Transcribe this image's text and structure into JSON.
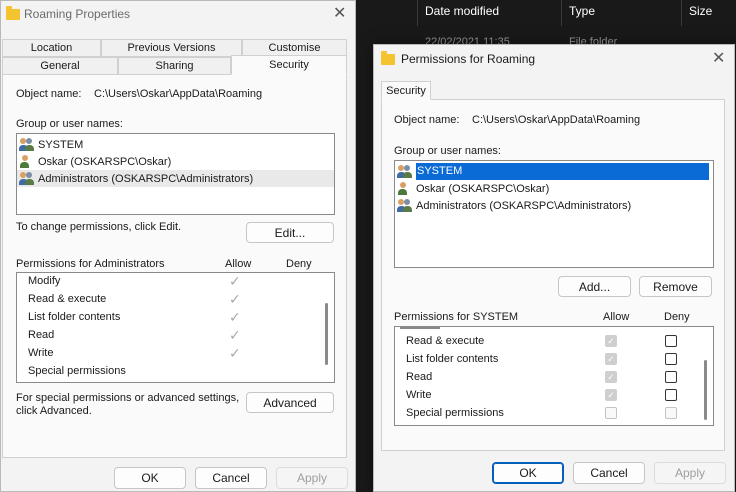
{
  "explorer": {
    "columns": [
      "Date modified",
      "Type",
      "Size"
    ],
    "partial_row": {
      "date": "22/02/2021 11:35",
      "type": "File folder"
    }
  },
  "props_window": {
    "title": "Roaming Properties",
    "tabs_row1": [
      "Location",
      "Previous Versions",
      "Customise"
    ],
    "tabs_row2": [
      "General",
      "Sharing",
      "Security"
    ],
    "selected_tab": "Security",
    "object_name_label": "Object name:",
    "object_name_value": "C:\\Users\\Oskar\\AppData\\Roaming",
    "group_label": "Group or user names:",
    "users": [
      "SYSTEM",
      "Oskar (OSKARSPC\\Oskar)",
      "Administrators (OSKARSPC\\Administrators)"
    ],
    "change_text": "To change permissions, click Edit.",
    "edit_button": "Edit...",
    "perm_header": "Permissions for Administrators",
    "allow_label": "Allow",
    "deny_label": "Deny",
    "permissions": [
      {
        "name": "Modify",
        "allow": true,
        "deny": false
      },
      {
        "name": "Read & execute",
        "allow": true,
        "deny": false
      },
      {
        "name": "List folder contents",
        "allow": true,
        "deny": false
      },
      {
        "name": "Read",
        "allow": true,
        "deny": false
      },
      {
        "name": "Write",
        "allow": true,
        "deny": false
      },
      {
        "name": "Special permissions",
        "allow": false,
        "deny": false
      }
    ],
    "advanced_text_line1": "For special permissions or advanced settings,",
    "advanced_text_line2": "click Advanced.",
    "advanced_button": "Advanced",
    "ok_button": "OK",
    "cancel_button": "Cancel",
    "apply_button": "Apply"
  },
  "perm_window": {
    "title": "Permissions for Roaming",
    "tab": "Security",
    "object_name_label": "Object name:",
    "object_name_value": "C:\\Users\\Oskar\\AppData\\Roaming",
    "group_label": "Group or user names:",
    "users": [
      "SYSTEM",
      "Oskar (OSKARSPC\\Oskar)",
      "Administrators (OSKARSPC\\Administrators)"
    ],
    "selected_user": "SYSTEM",
    "add_button": "Add...",
    "remove_button": "Remove",
    "perm_header": "Permissions for SYSTEM",
    "allow_label": "Allow",
    "deny_label": "Deny",
    "permissions": [
      {
        "name": "Read & execute",
        "allow": true,
        "deny": false
      },
      {
        "name": "List folder contents",
        "allow": true,
        "deny": false
      },
      {
        "name": "Read",
        "allow": true,
        "deny": false
      },
      {
        "name": "Write",
        "allow": true,
        "deny": false
      },
      {
        "name": "Special permissions",
        "allow": false,
        "deny": false
      }
    ],
    "ok_button": "OK",
    "cancel_button": "Cancel",
    "apply_button": "Apply"
  },
  "colors": {
    "accent": "#0a6ad6",
    "folder": "#f4c430",
    "dark_bg": "#191919"
  }
}
